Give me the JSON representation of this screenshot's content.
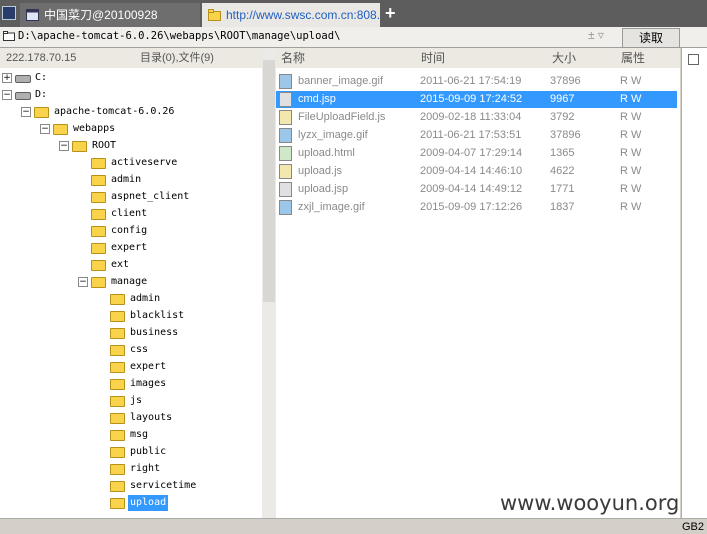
{
  "tabs": [
    {
      "label": "中国菜刀@20100928"
    },
    {
      "label": "http://www.swsc.com.cn:808..."
    }
  ],
  "new_tab": "+",
  "address": {
    "path": "D:\\apache-tomcat-6.0.26\\webapps\\ROOT\\manage\\upload\\",
    "pm": "± ▿",
    "read_label": "读取"
  },
  "left_header": {
    "ip": "222.178.70.15",
    "counts": "目录(0),文件(9)"
  },
  "tree": [
    {
      "label": "C:",
      "depth": 0,
      "type": "drive",
      "exp": "+"
    },
    {
      "label": "D:",
      "depth": 0,
      "type": "drive",
      "exp": "−"
    },
    {
      "label": "apache-tomcat-6.0.26",
      "depth": 1,
      "type": "folder",
      "exp": "−"
    },
    {
      "label": "webapps",
      "depth": 2,
      "type": "folder",
      "exp": "−"
    },
    {
      "label": "ROOT",
      "depth": 3,
      "type": "folder",
      "exp": "−"
    },
    {
      "label": "activeserve",
      "depth": 4,
      "type": "folder"
    },
    {
      "label": "admin",
      "depth": 4,
      "type": "folder"
    },
    {
      "label": "aspnet_client",
      "depth": 4,
      "type": "folder"
    },
    {
      "label": "client",
      "depth": 4,
      "type": "folder"
    },
    {
      "label": "config",
      "depth": 4,
      "type": "folder"
    },
    {
      "label": "expert",
      "depth": 4,
      "type": "folder"
    },
    {
      "label": "ext",
      "depth": 4,
      "type": "folder"
    },
    {
      "label": "manage",
      "depth": 4,
      "type": "folder",
      "exp": "−"
    },
    {
      "label": "admin",
      "depth": 5,
      "type": "folder"
    },
    {
      "label": "blacklist",
      "depth": 5,
      "type": "folder"
    },
    {
      "label": "business",
      "depth": 5,
      "type": "folder"
    },
    {
      "label": "css",
      "depth": 5,
      "type": "folder"
    },
    {
      "label": "expert",
      "depth": 5,
      "type": "folder"
    },
    {
      "label": "images",
      "depth": 5,
      "type": "folder"
    },
    {
      "label": "js",
      "depth": 5,
      "type": "folder"
    },
    {
      "label": "layouts",
      "depth": 5,
      "type": "folder"
    },
    {
      "label": "msg",
      "depth": 5,
      "type": "folder"
    },
    {
      "label": "public",
      "depth": 5,
      "type": "folder"
    },
    {
      "label": "right",
      "depth": 5,
      "type": "folder"
    },
    {
      "label": "servicetime",
      "depth": 5,
      "type": "folder"
    },
    {
      "label": "upload",
      "depth": 5,
      "type": "folder",
      "selected": true
    }
  ],
  "columns": {
    "name": "名称",
    "time": "时间",
    "size": "大小",
    "attr": "属性"
  },
  "files": [
    {
      "name": "banner_image.gif",
      "time": "2011-06-21 17:54:19",
      "size": "37896",
      "attr": "R W",
      "icon": "image-file-icon"
    },
    {
      "name": "cmd.jsp",
      "time": "2015-09-09 17:24:52",
      "size": "9967",
      "attr": "R W",
      "icon": "jsp-file-icon",
      "selected": true
    },
    {
      "name": "FileUploadField.js",
      "time": "2009-02-18 11:33:04",
      "size": "3792",
      "attr": "R W",
      "icon": "script-file-icon"
    },
    {
      "name": "lyzx_image.gif",
      "time": "2011-06-21 17:53:51",
      "size": "37896",
      "attr": "R W",
      "icon": "image-file-icon"
    },
    {
      "name": "upload.html",
      "time": "2009-04-07 17:29:14",
      "size": "1365",
      "attr": "R W",
      "icon": "html-file-icon"
    },
    {
      "name": "upload.js",
      "time": "2009-04-14 14:46:10",
      "size": "4622",
      "attr": "R W",
      "icon": "script-file-icon"
    },
    {
      "name": "upload.jsp",
      "time": "2009-04-14 14:49:12",
      "size": "1771",
      "attr": "R W",
      "icon": "jsp-file-icon"
    },
    {
      "name": "zxjl_image.gif",
      "time": "2015-09-09 17:12:26",
      "size": "1837",
      "attr": "R W",
      "icon": "image-file-icon"
    }
  ],
  "status": {
    "encoding": "GB2",
    "watermark": "www.wooyun.org"
  },
  "colors": {
    "selection": "#3399ff",
    "folder": "#f9d44a",
    "tabbar": "#5d5d5d"
  }
}
